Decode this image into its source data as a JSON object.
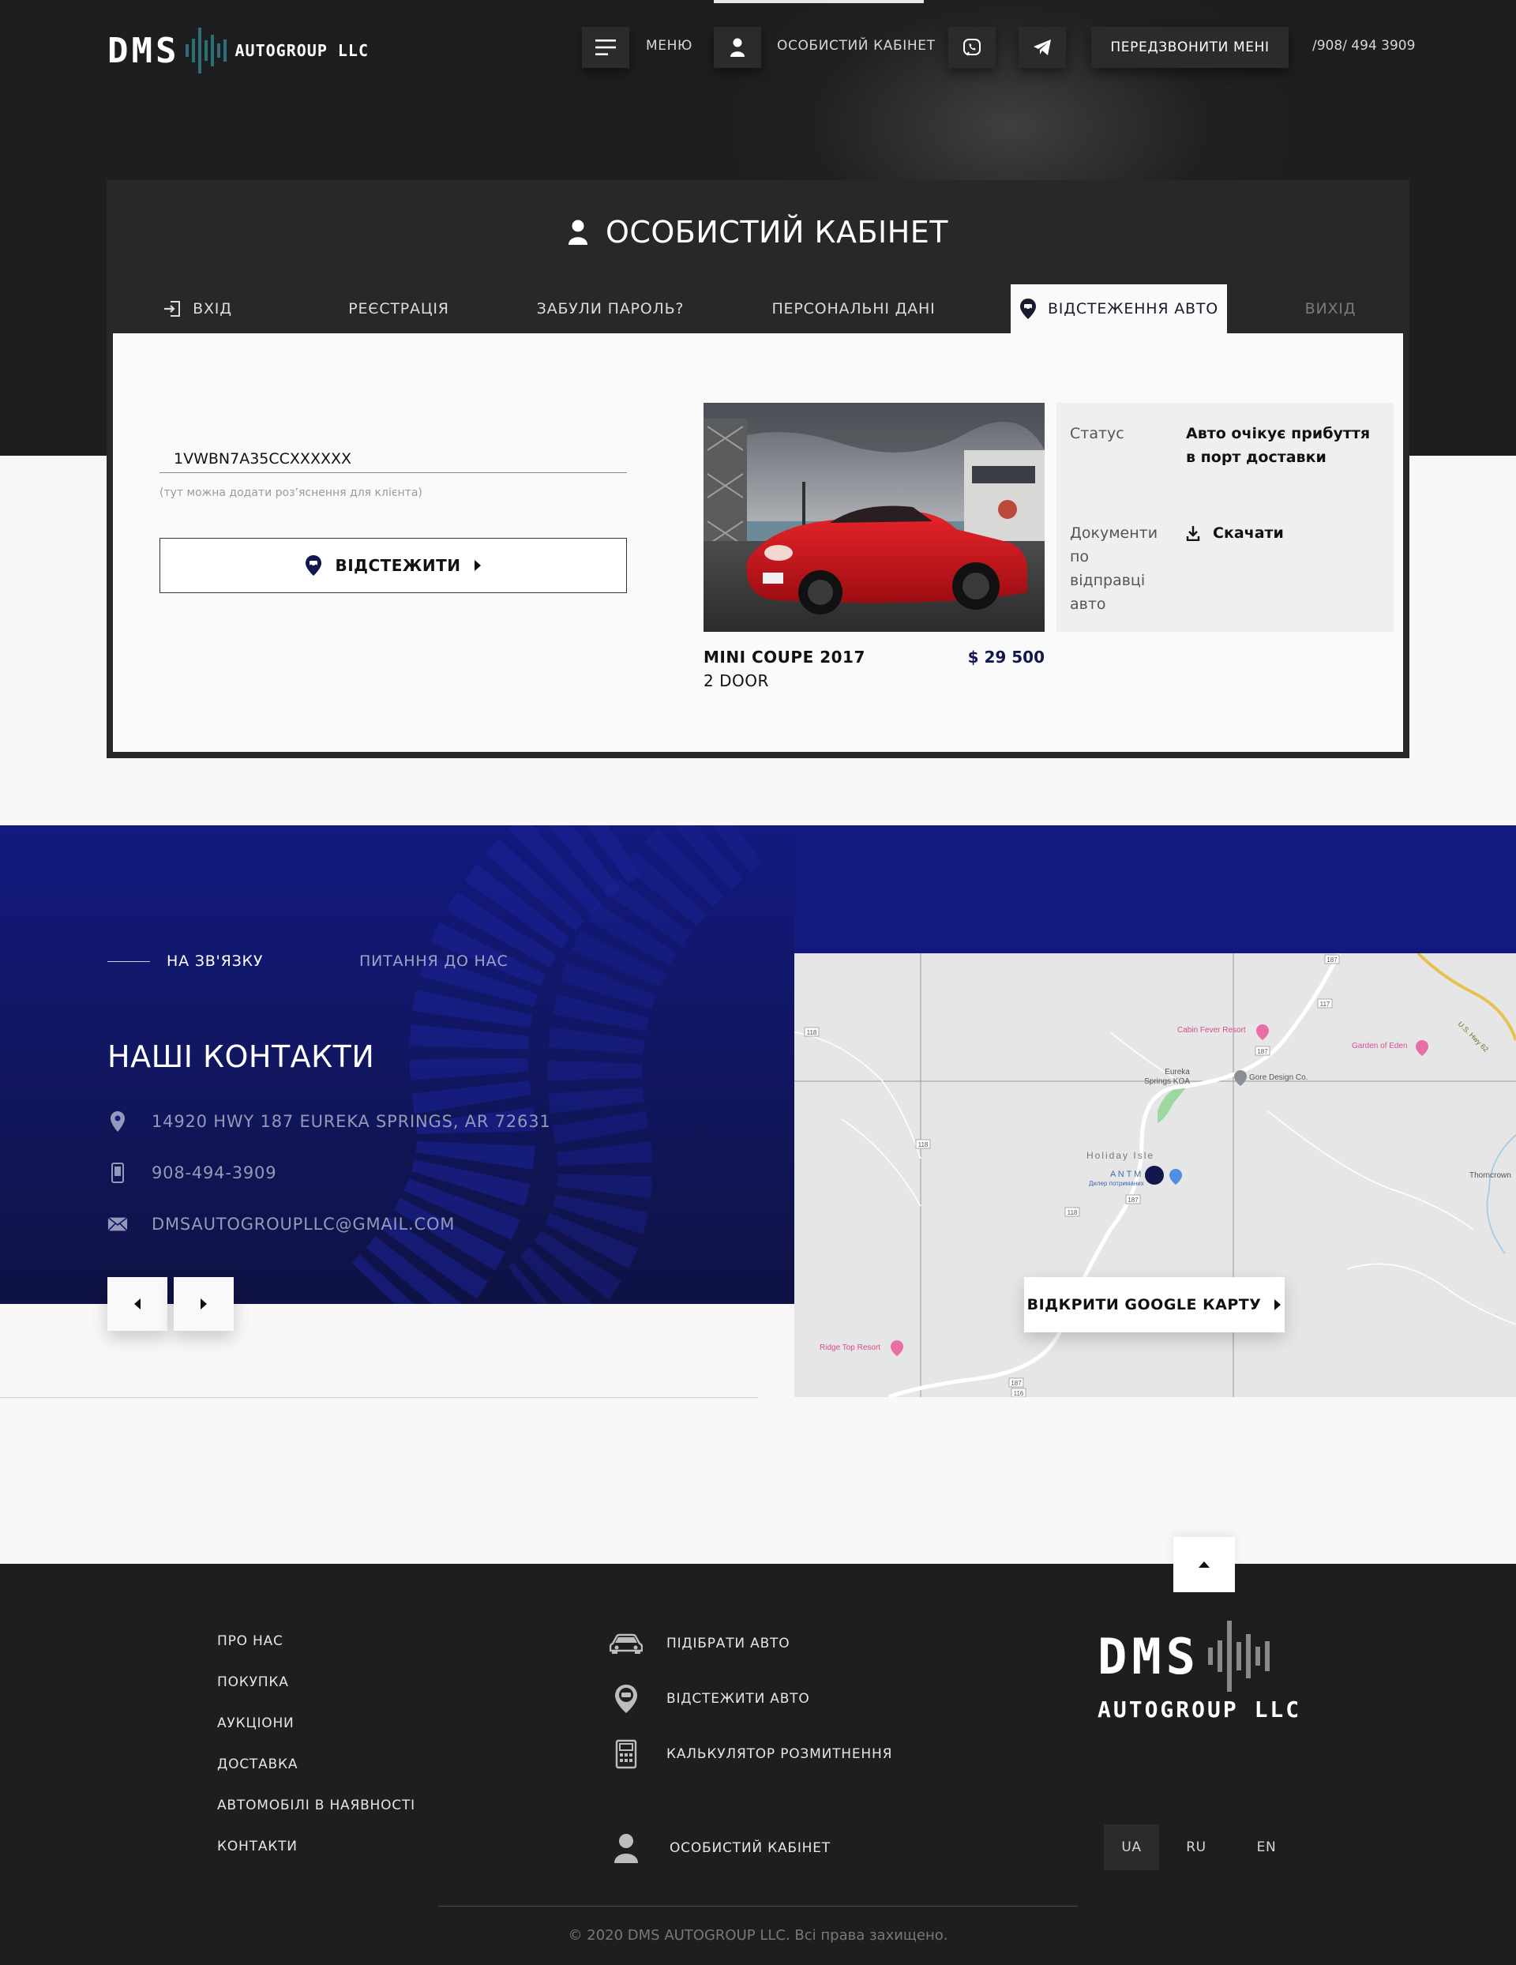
{
  "header": {
    "logo_dms": "DMS",
    "logo_autogroup": "AUTOGROUP LLC",
    "menu_label": "МЕНЮ",
    "cabinet_label": "ОСОБИСТИЙ КАБІНЕТ",
    "callback_label": "ПЕРЕДЗВОНИТИ МЕНІ",
    "phone": "/908/ 494 3909"
  },
  "cabinet": {
    "title": "ОСОБИСТИЙ КАБІНЕТ",
    "tabs": [
      {
        "label": "ВХІД",
        "icon": "login-icon"
      },
      {
        "label": "РЕЄСТРАЦІЯ"
      },
      {
        "label": "ЗАБУЛИ ПАРОЛЬ?"
      },
      {
        "label": "ПЕРСОНАЛЬНІ ДАНІ"
      },
      {
        "label": "ВІДСТЕЖЕННЯ АВТО",
        "icon": "car-location-icon",
        "active": true
      },
      {
        "label": "ВИХІД"
      }
    ],
    "vin_value": "1VWBN7A35CCXXXXXX",
    "vin_hint": "(тут можна додати розʼяснення для клієнта)",
    "track_button": "ВІДСТЕЖИТИ",
    "car": {
      "name": "MINI COUPE 2017",
      "subtitle": "2 DOOR",
      "price": "$ 29 500"
    },
    "status": {
      "status_label": "Статус",
      "status_value": "Авто очікує прибуття в порт доставки",
      "docs_label": "Документи по відправці авто",
      "download_label": "Скачати"
    }
  },
  "contacts": {
    "tab_active": "НА ЗВ'ЯЗКУ",
    "tab_other": "ПИТАННЯ ДО НАС",
    "title": "НАШІ КОНТАКТИ",
    "address": "14920 HWY 187  EUREKA SPRINGS, AR 72631",
    "phone": "908-494-3909",
    "email": "DMSAUTOGROUPLLC@GMAIL.COM",
    "map_button": "ВІДКРИТИ GOOGLE КАРТУ",
    "map_labels": {
      "cabin_fever": "Cabin Fever Resort",
      "garden": "Garden of Eden",
      "gore": "Gore Design Co.",
      "eureka_koa_1": "Eureka",
      "eureka_koa_2": "Springs KOA",
      "holiday": "Holiday Isle",
      "ant_motors": "A N T M",
      "ant_motors_sub": "Дилер потриманих",
      "thorncrown": "Thorncrown",
      "ridge_top": "Ridge Top Resort",
      "us_hwy": "U.S. Hwy 62",
      "r118a": "118",
      "r118b": "118",
      "r118c": "118",
      "r187a": "187",
      "r187b": "187",
      "r187c": "187",
      "r116": "116",
      "r117": "117",
      "r187d": "187"
    }
  },
  "footer": {
    "links": [
      "ПРО НАС",
      "ПОКУПКА",
      "АУКЦІОНИ",
      "ДОСТАВКА",
      "АВТОМОБІЛІ В НАЯВНОСТІ",
      "КОНТАКТИ"
    ],
    "services": [
      {
        "label": "ПІДІБРАТИ АВТО",
        "icon": "car-icon"
      },
      {
        "label": "ВІДСТЕЖИТИ АВТО",
        "icon": "car-location-icon"
      },
      {
        "label": "КАЛЬКУЛЯТОР РОЗМИТНЕННЯ",
        "icon": "calculator-icon"
      }
    ],
    "cabinet_label": "ОСОБИСТИЙ КАБІНЕТ",
    "logo_dms": "DMS",
    "logo_autogroup": "AUTOGROUP  LLC",
    "languages": [
      {
        "label": "UA",
        "active": true
      },
      {
        "label": "RU"
      },
      {
        "label": "EN"
      }
    ],
    "copyright": "© 2020 DMS AUTOGROUP LLC. Всі права захищено."
  }
}
